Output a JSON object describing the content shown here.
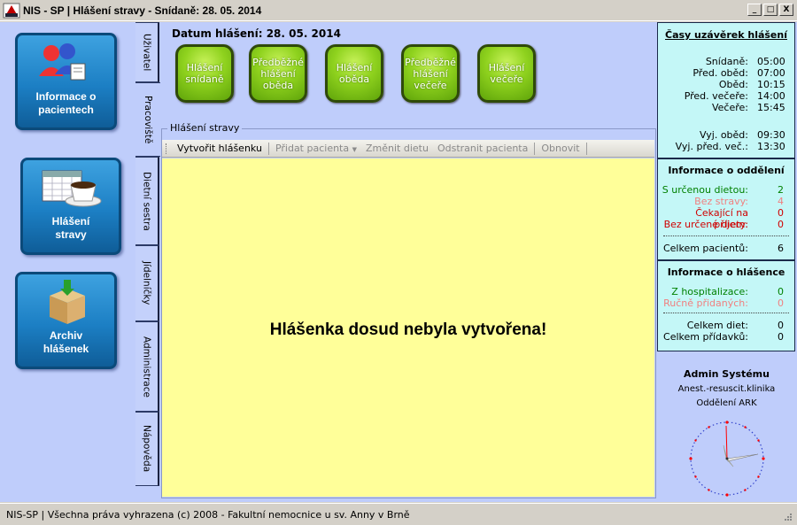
{
  "window": {
    "title": "NIS - SP | Hlášení stravy - Snídaně: 28. 05. 2014",
    "buttons": [
      "_",
      "□",
      "X"
    ]
  },
  "left_nav": [
    {
      "label": "Informace o pacientech",
      "icon": "patients-icon"
    },
    {
      "label": "Hlášení stravy",
      "icon": "coffee-calendar-icon"
    },
    {
      "label": "Archiv hlášenek",
      "icon": "archive-box-icon"
    }
  ],
  "tabs": [
    "Uživatel",
    "Pracoviště",
    "Dietní sestra",
    "Jídelníčky",
    "Administrace",
    "Nápověda"
  ],
  "header": {
    "datum_label": "Datum hlášení: 28. 05. 2014"
  },
  "green_buttons": [
    "Hlášení snídaně",
    "Předběžné hlášení oběda",
    "Hlášení oběda",
    "Předběžné hlášení večeře",
    "Hlášení večeře"
  ],
  "group": {
    "label": "Hlášení stravy",
    "toolbar": {
      "create": "Vytvořit hlášenku",
      "add_patient": "Přidat pacienta",
      "change_diet": "Změnit dietu",
      "remove_patient": "Odstranit pacienta",
      "refresh": "Obnovit"
    },
    "message": "Hlášenka dosud nebyla vytvořena!"
  },
  "deadlines": {
    "title": "Časy uzávěrek hlášení",
    "rows": [
      {
        "k": "Snídaně:",
        "v": "05:00"
      },
      {
        "k": "Před. oběd:",
        "v": "07:00"
      },
      {
        "k": "Oběd:",
        "v": "10:15"
      },
      {
        "k": "Před. večeře:",
        "v": "14:00"
      },
      {
        "k": "Večeře:",
        "v": "15:45"
      },
      {
        "k": "Vyj. oběd:",
        "v": "09:30"
      },
      {
        "k": "Vyj. před. več.:",
        "v": "13:30"
      }
    ]
  },
  "dept_info": {
    "title": "Informace o oddělení",
    "rows": [
      {
        "k": "S určenou dietou:",
        "v": "2",
        "color": "#008000"
      },
      {
        "k": "Bez stravy:",
        "v": "4",
        "color": "#f08080"
      },
      {
        "k": "Čekající na příjem:",
        "v": "0",
        "color": "#d00000"
      },
      {
        "k": "Bez určené diety:",
        "v": "0",
        "color": "#d00000"
      }
    ],
    "total": {
      "k": "Celkem pacientů:",
      "v": "6"
    }
  },
  "report_info": {
    "title": "Informace o hlášence",
    "rows": [
      {
        "k": "Z hospitalizace:",
        "v": "0",
        "color": "#008000"
      },
      {
        "k": "Ručně přidaných:",
        "v": "0",
        "color": "#f08080"
      }
    ],
    "totals": [
      {
        "k": "Celkem diet:",
        "v": "0"
      },
      {
        "k": "Celkem přídavků:",
        "v": "0"
      }
    ]
  },
  "user": {
    "name": "Admin Systému",
    "clinic": "Anest.-resuscit.klinika",
    "department": "Oddělení ARK"
  },
  "colors": {
    "client_bg": "#bfcdfb",
    "panel_bg": "#c4f7f7",
    "content_bg": "#ffff99",
    "green_button": "#8fd21e"
  },
  "status": "NIS-SP | Všechna práva vyhrazena (c) 2008 - Fakultní nemocnice u sv. Anny v Brně"
}
